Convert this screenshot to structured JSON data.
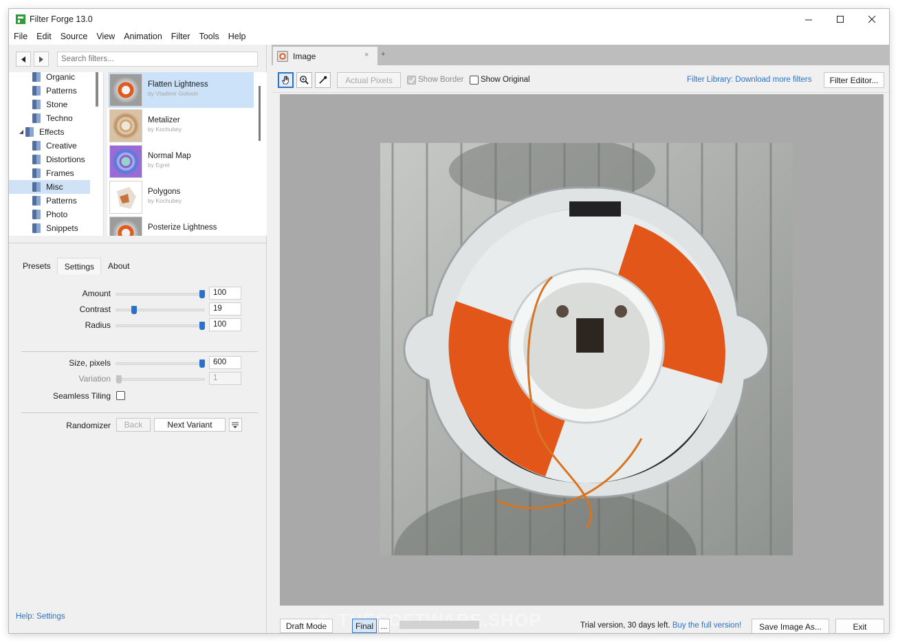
{
  "window": {
    "title": "Filter Forge 13.0"
  },
  "menu": [
    "File",
    "Edit",
    "Source",
    "View",
    "Animation",
    "Filter",
    "Tools",
    "Help"
  ],
  "search": {
    "placeholder": "Search filters..."
  },
  "tree": {
    "items": [
      {
        "label": "Organic",
        "selected": false
      },
      {
        "label": "Patterns",
        "selected": false
      },
      {
        "label": "Stone",
        "selected": false
      },
      {
        "label": "Techno",
        "selected": false
      },
      {
        "label": "Effects",
        "selected": false,
        "expanded": true
      },
      {
        "label": "Creative",
        "selected": false
      },
      {
        "label": "Distortions",
        "selected": false
      },
      {
        "label": "Frames",
        "selected": false
      },
      {
        "label": "Misc",
        "selected": true
      },
      {
        "label": "Patterns",
        "selected": false
      },
      {
        "label": "Photo",
        "selected": false
      },
      {
        "label": "Snippets",
        "selected": false
      }
    ]
  },
  "filters": [
    {
      "name": "Flatten Lightness",
      "author": "by Vladimir Golovin",
      "selected": true
    },
    {
      "name": "Metalizer",
      "author": "by Kochubey",
      "selected": false
    },
    {
      "name": "Normal Map",
      "author": "by Egret",
      "selected": false
    },
    {
      "name": "Polygons",
      "author": "by Kochubey",
      "selected": false
    },
    {
      "name": "Posterize Lightness",
      "author": "",
      "selected": false
    }
  ],
  "tabs": {
    "presets": "Presets",
    "settings": "Settings",
    "about": "About",
    "active": "Settings"
  },
  "params": {
    "amount": {
      "label": "Amount",
      "value": "100",
      "level": 1.0
    },
    "contrast": {
      "label": "Contrast",
      "value": "19",
      "level": 0.19
    },
    "radius": {
      "label": "Radius",
      "value": "100",
      "level": 1.0
    },
    "size": {
      "label": "Size, pixels",
      "value": "600",
      "level": 1.0
    },
    "variation": {
      "label": "Variation",
      "value": "1",
      "level": 0.0
    },
    "seamless": {
      "label": "Seamless Tiling",
      "checked": false
    }
  },
  "randomizer": {
    "label": "Randomizer",
    "back": "Back",
    "next": "Next Variant"
  },
  "help": {
    "label": "Help: Settings"
  },
  "document": {
    "tab_label": "Image",
    "close": "×",
    "add": "+"
  },
  "toolbar": {
    "actual_pixels": "Actual Pixels",
    "show_border": "Show Border",
    "show_border_checked": true,
    "show_original": "Show Original",
    "show_original_checked": false,
    "library_link": "Filter Library: Download more filters",
    "filter_editor": "Filter Editor..."
  },
  "bottom": {
    "draft_mode": "Draft Mode",
    "final": "Final",
    "more": "...",
    "trial_text": "Trial version, 30 days left.",
    "buy_link": "Buy the full version!",
    "save": "Save Image As...",
    "exit": "Exit",
    "watermark": "© THESOFTWARE.SHOP"
  },
  "colors": {
    "accent": "#2a72c9",
    "selection": "#cce2f8",
    "lifebuoy_orange": "#e2561a"
  }
}
